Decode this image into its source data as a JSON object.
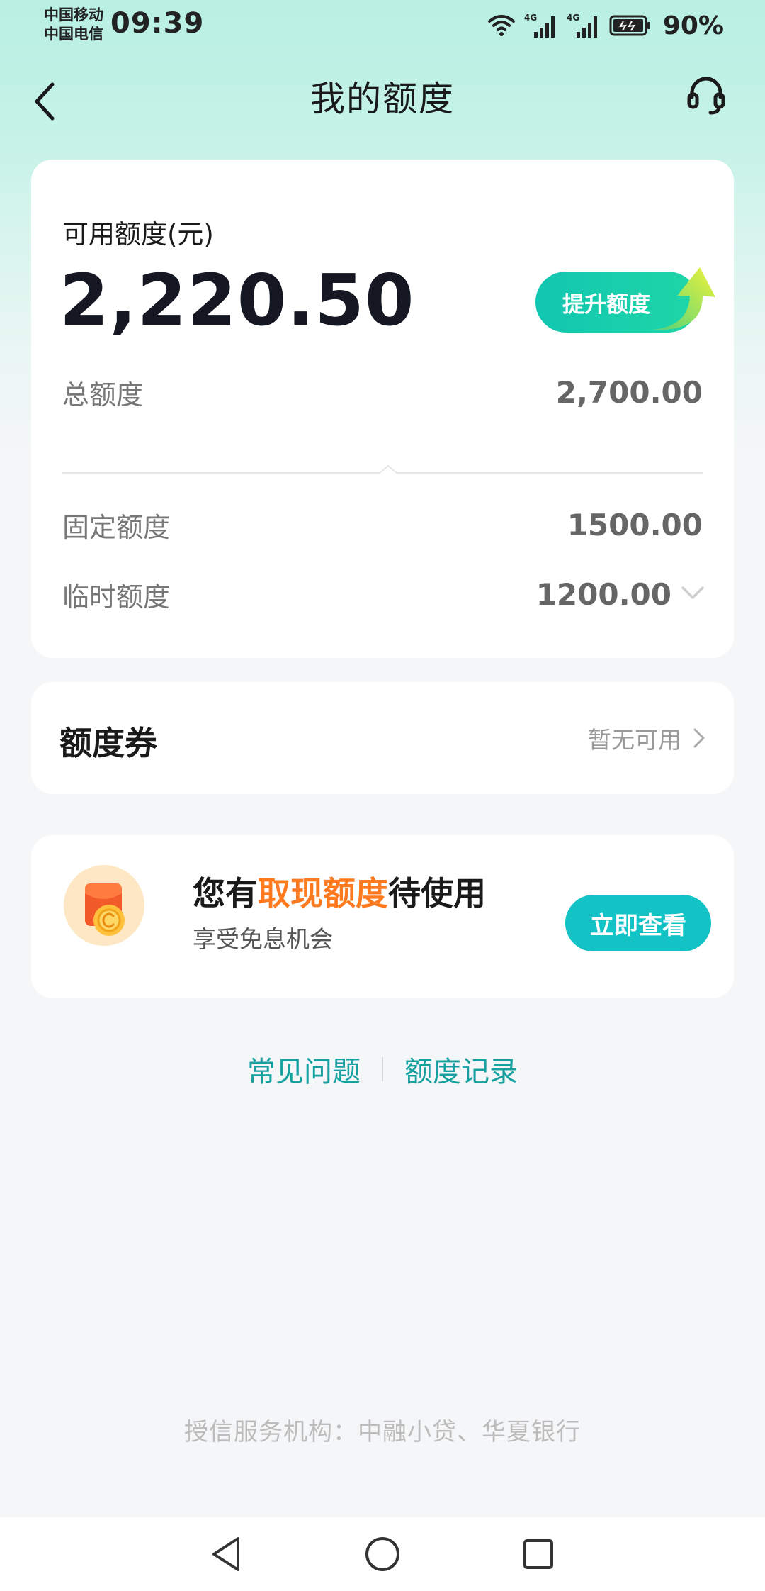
{
  "status_bar": {
    "carrier_1": "中国移动",
    "carrier_2": "中国电信",
    "time": "09:39",
    "battery": "90%",
    "network_1": "4G",
    "network_2": "4G"
  },
  "header": {
    "title": "我的额度",
    "back_icon": "chevron-left-icon",
    "service_icon": "headset-icon"
  },
  "quota": {
    "label": "可用额度(元)",
    "available": "2,220.50",
    "raise_button": "提升额度",
    "total_label": "总额度",
    "total_value": "2,700.00",
    "fixed_label": "固定额度",
    "fixed_value": "1500.00",
    "temp_label": "临时额度",
    "temp_value": "1200.00"
  },
  "coupon": {
    "title": "额度券",
    "status": "暂无可用"
  },
  "promo": {
    "title_prefix": "您有",
    "title_highlight": "取现额度",
    "title_suffix": "待使用",
    "subtitle": "享受免息机会",
    "button": "立即查看",
    "highlight_color": "#ff7a1f"
  },
  "links": {
    "faq": "常见问题",
    "records": "额度记录"
  },
  "footer": {
    "note": "授信服务机构：中融小贷、华夏银行"
  },
  "colors": {
    "accent": "#12c2c4",
    "link": "#16a0a0",
    "header_bg": "#b9f0e3"
  }
}
